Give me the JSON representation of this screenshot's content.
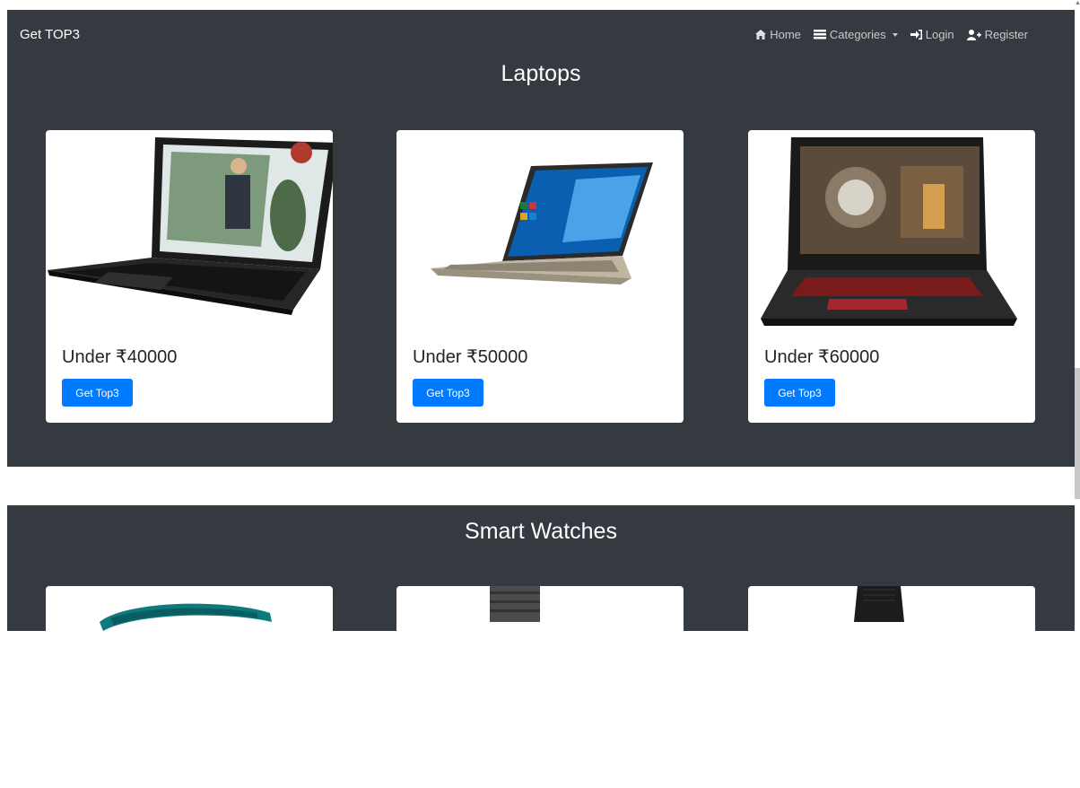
{
  "navbar": {
    "brand": "Get TOP3",
    "links": [
      {
        "label": "Home",
        "icon": "home-icon"
      },
      {
        "label": "Categories",
        "icon": "list-icon"
      },
      {
        "label": "Login",
        "icon": "sign-in-icon"
      },
      {
        "label": "Register",
        "icon": "user-plus-icon"
      }
    ]
  },
  "sections": [
    {
      "title": "Laptops",
      "cards": [
        {
          "price": "Under ₹40000",
          "button": "Get Top3",
          "image": "hp-laptop-image"
        },
        {
          "price": "Under ₹50000",
          "button": "Get Top3",
          "image": "silver-laptop-image"
        },
        {
          "price": "Under ₹60000",
          "button": "Get Top3",
          "image": "gaming-laptop-image"
        }
      ]
    },
    {
      "title": "Smart Watches",
      "cards": [
        {
          "image": "teal-band-image"
        },
        {
          "image": "metal-watch-image"
        },
        {
          "image": "black-watch-image"
        }
      ]
    }
  ],
  "colors": {
    "section_bg": "#343a40",
    "button": "#007bff"
  }
}
